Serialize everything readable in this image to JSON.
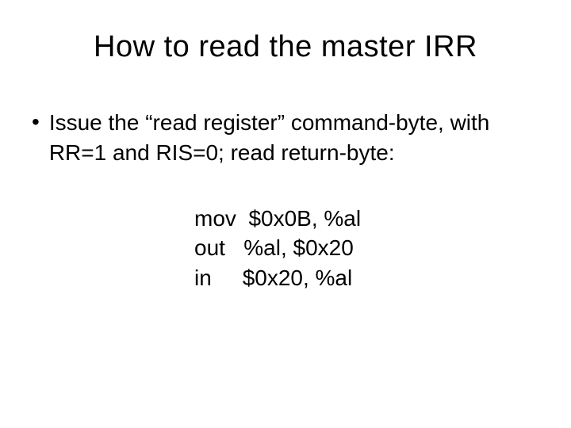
{
  "title": "How to read the master IRR",
  "bullet": {
    "dot": "•",
    "text": "Issue the “read register” command-byte, with RR=1 and RIS=0; read return-byte:"
  },
  "code": {
    "line1": "mov  $0x0B, %al",
    "line2": "out   %al, $0x20",
    "line3": "in     $0x20, %al"
  }
}
